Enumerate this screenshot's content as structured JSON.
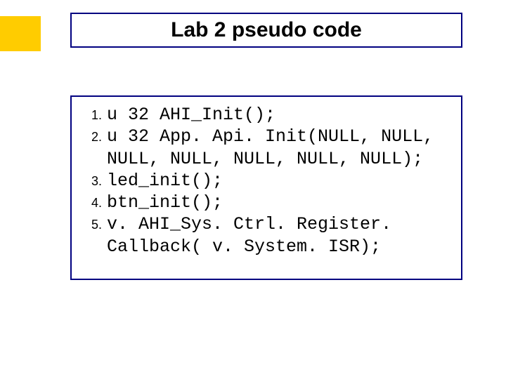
{
  "title": "Lab 2 pseudo code",
  "code": {
    "lines": [
      "u 32 AHI_Init();",
      "u 32 App. Api. Init(NULL, NULL, NULL, NULL, NULL, NULL, NULL);",
      "led_init();",
      "btn_init();",
      "v. AHI_Sys. Ctrl. Register. Callback( v. System. ISR);"
    ]
  }
}
